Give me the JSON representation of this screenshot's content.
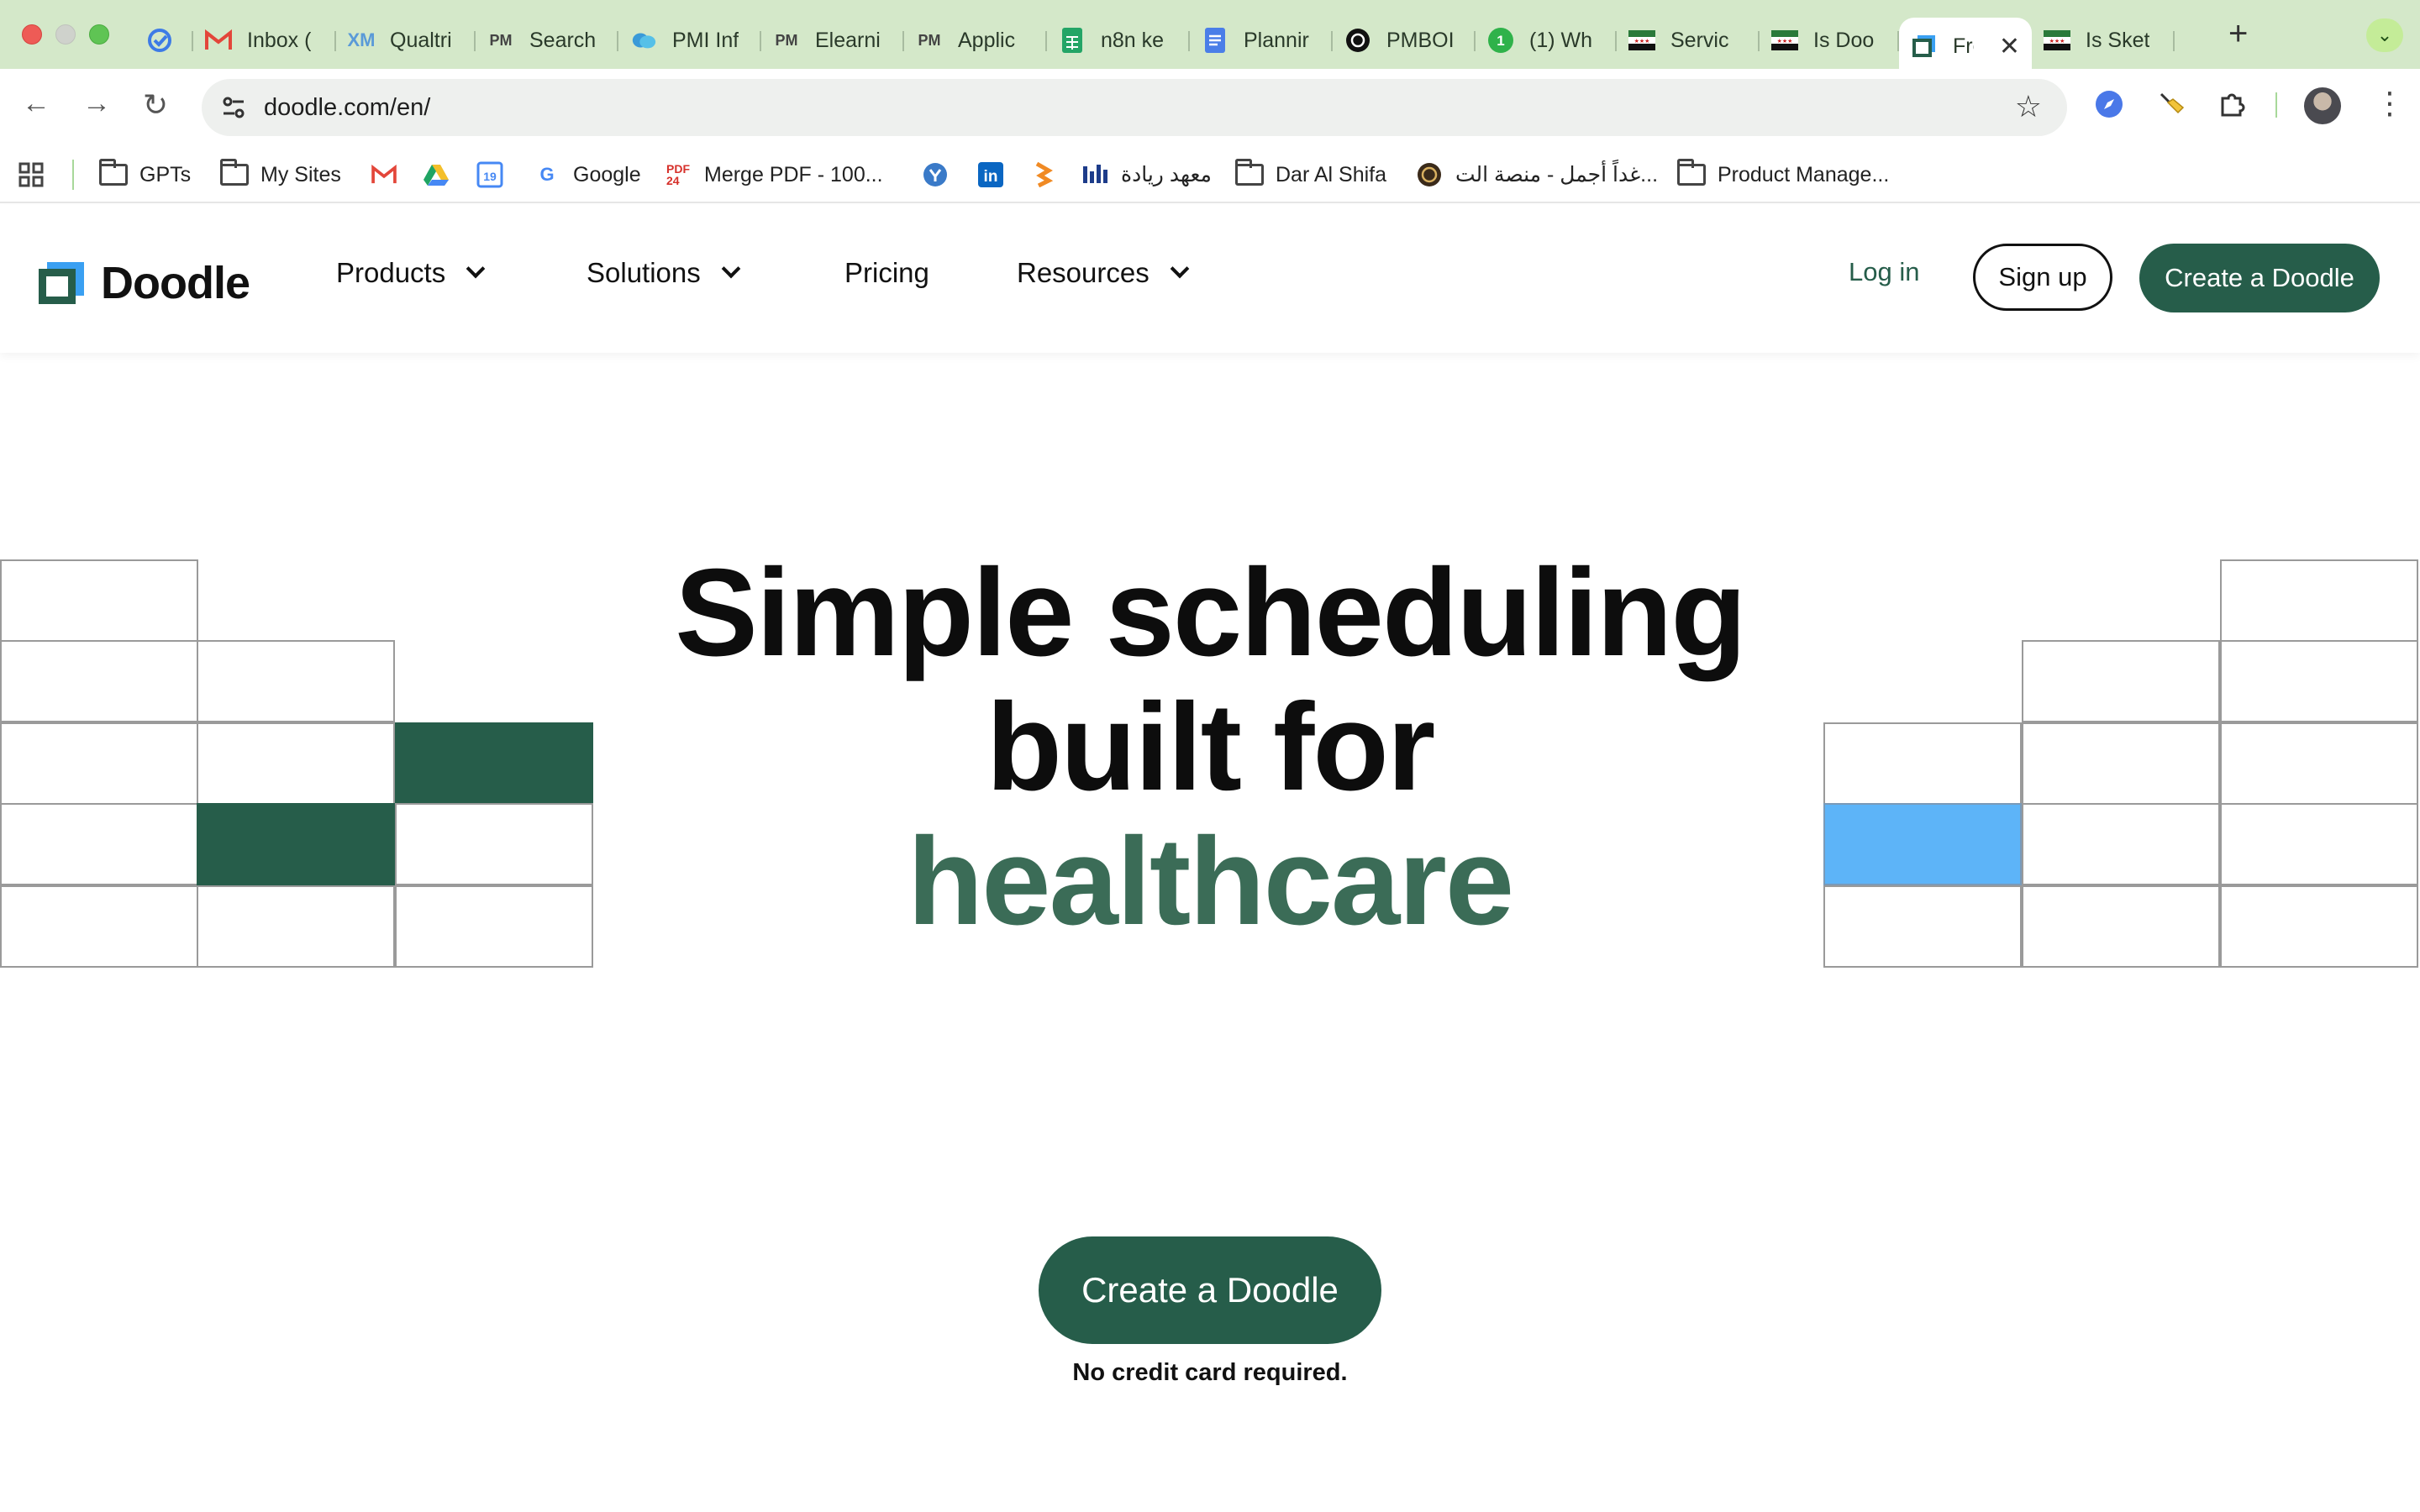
{
  "browser": {
    "tabs": [
      {
        "label": "",
        "icon": "todo-check-icon"
      },
      {
        "label": "Inbox (",
        "icon": "gmail-icon"
      },
      {
        "label": "Qualtri",
        "icon": "qualtrics-icon"
      },
      {
        "label": "Search",
        "icon": "pmi-icon"
      },
      {
        "label": "PMI Inf",
        "icon": "cloud-icon"
      },
      {
        "label": "Elearni",
        "icon": "pmi-icon"
      },
      {
        "label": "Applic",
        "icon": "pmi-icon"
      },
      {
        "label": "n8n ke",
        "icon": "sheets-icon"
      },
      {
        "label": "Plannir",
        "icon": "docs-icon"
      },
      {
        "label": "PMBOI",
        "icon": "openai-icon"
      },
      {
        "label": "(1) Wh",
        "icon": "whatsapp-icon"
      },
      {
        "label": "Servic",
        "icon": "flag-icon"
      },
      {
        "label": "Is Doo",
        "icon": "flag-icon"
      },
      {
        "label": "Fre",
        "icon": "doodle-icon",
        "active": true
      },
      {
        "label": "Is Sket",
        "icon": "flag-icon"
      }
    ],
    "url": "doodle.com/en/",
    "bookmarks": [
      {
        "label": "GPTs",
        "icon": "folder-icon"
      },
      {
        "label": "My Sites",
        "icon": "folder-icon"
      },
      {
        "label": "",
        "icon": "gmail-icon"
      },
      {
        "label": "",
        "icon": "drive-icon"
      },
      {
        "label": "",
        "icon": "calendar-icon",
        "badge": "19"
      },
      {
        "label": "Google",
        "icon": "google-icon"
      },
      {
        "label": "Merge PDF - 100...",
        "icon": "pdf24-icon"
      },
      {
        "label": "",
        "icon": "shield-icon"
      },
      {
        "label": "",
        "icon": "linkedin-icon"
      },
      {
        "label": "",
        "icon": "tag-icon"
      },
      {
        "label": "معهد ريادة",
        "icon": "bars-icon"
      },
      {
        "label": "Dar Al Shifa",
        "icon": "folder-icon"
      },
      {
        "label": "غداً أجمل - منصة الت...",
        "icon": "emblem-icon"
      },
      {
        "label": "Product Manage...",
        "icon": "folder-icon"
      }
    ]
  },
  "site": {
    "logo": "Doodle",
    "nav": [
      {
        "label": "Products",
        "dropdown": true
      },
      {
        "label": "Solutions",
        "dropdown": true
      },
      {
        "label": "Pricing",
        "dropdown": false
      },
      {
        "label": "Resources",
        "dropdown": true
      }
    ],
    "login": "Log in",
    "signup": "Sign up",
    "create": "Create a Doodle"
  },
  "hero": {
    "title_line1": "Simple scheduling",
    "title_line2": "built for",
    "title_accent": "healthcare",
    "cta": "Create a Doodle",
    "note": "No credit card required."
  },
  "colors": {
    "brand_green": "#265d4a",
    "accent_green": "#3b6c57",
    "highlight_blue": "#5db4f8",
    "tab_strip": "#d4e8c9"
  }
}
